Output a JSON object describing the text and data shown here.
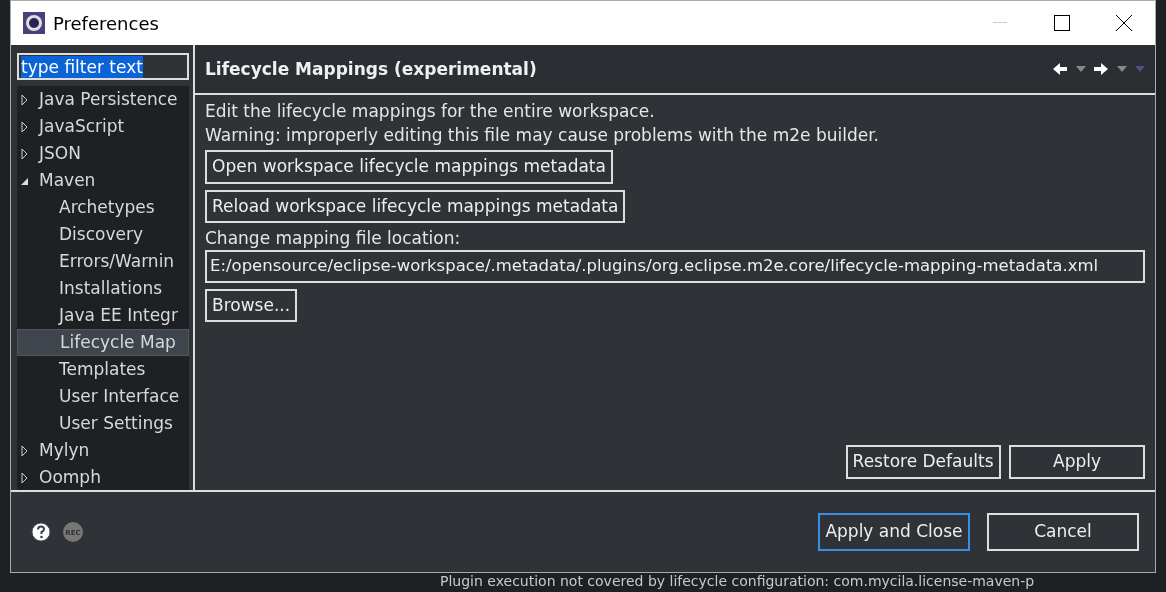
{
  "window": {
    "title": "Preferences"
  },
  "filter": {
    "value": "type filter text"
  },
  "tree": [
    {
      "label": "Java Persistence",
      "expanded": false,
      "selected": false
    },
    {
      "label": "JavaScript",
      "expanded": false,
      "selected": false
    },
    {
      "label": "JSON",
      "expanded": false,
      "selected": false
    },
    {
      "label": "Maven",
      "expanded": true,
      "selected": false,
      "children": [
        {
          "label": "Archetypes",
          "selected": false
        },
        {
          "label": "Discovery",
          "selected": false
        },
        {
          "label": "Errors/Warnin",
          "selected": false
        },
        {
          "label": "Installations",
          "selected": false
        },
        {
          "label": "Java EE Integr",
          "selected": false
        },
        {
          "label": "Lifecycle Map",
          "selected": true
        },
        {
          "label": "Templates",
          "selected": false
        },
        {
          "label": "User Interface",
          "selected": false
        },
        {
          "label": "User Settings",
          "selected": false
        }
      ]
    },
    {
      "label": "Mylyn",
      "expanded": false,
      "selected": false
    },
    {
      "label": "Oomph",
      "expanded": false,
      "selected": false
    }
  ],
  "page": {
    "title": "Lifecycle Mappings (experimental)",
    "description": "Edit the lifecycle mappings for the entire workspace.",
    "warning": "Warning: improperly editing this file may cause problems with the m2e builder.",
    "open_button": "Open workspace lifecycle mappings metadata",
    "reload_button": "Reload workspace lifecycle mappings metadata",
    "location_label": "Change mapping file location:",
    "location_value": "E:/opensource/eclipse-workspace/.metadata/.plugins/org.eclipse.m2e.core/lifecycle-mapping-metadata.xml",
    "browse_button": "Browse...",
    "restore_button": "Restore Defaults",
    "apply_button": "Apply"
  },
  "footer": {
    "record_label": "REC",
    "buttons": [
      {
        "label": "Apply and Close",
        "focused": true
      },
      {
        "label": "Cancel",
        "focused": false
      }
    ]
  },
  "background_text": "Plugin execution not covered by lifecycle configuration: com.mycila.license-maven-p"
}
